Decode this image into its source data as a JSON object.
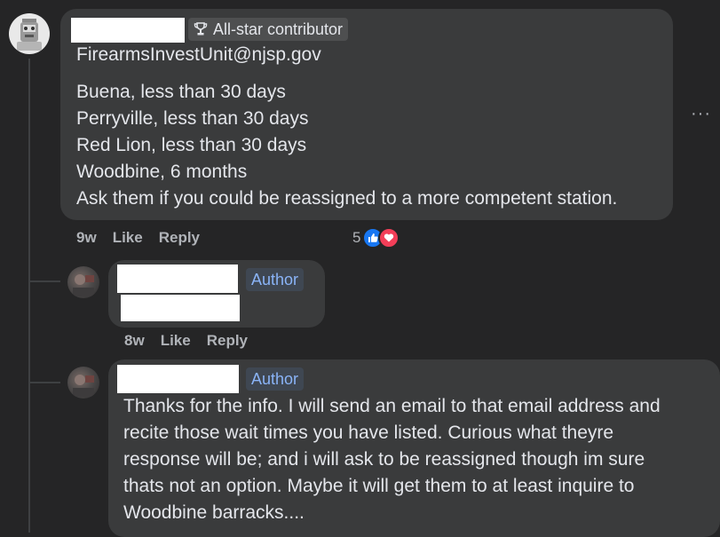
{
  "comments": [
    {
      "badge": "All-star contributor",
      "lines": [
        "FirearmsInvestUnit@njsp.gov",
        "Buena, less than 30 days",
        "Perryville, less than 30 days",
        "Red Lion, less than 30 days",
        "Woodbine, 6 months",
        "Ask them if you could be reassigned to a more competent station."
      ],
      "time": "9w",
      "like_label": "Like",
      "reply_label": "Reply",
      "reaction_count": "5",
      "more_label": "···"
    },
    {
      "badge": "Author",
      "time": "8w",
      "like_label": "Like",
      "reply_label": "Reply"
    },
    {
      "badge": "Author",
      "lines": [
        "Thanks for the info. I will send an email to that email address and",
        "recite those wait times you have listed. Curious what theyre",
        "response will be; and i will ask to be reassigned though im sure",
        "thats not an option. Maybe it will get them to at least inquire to",
        "Woodbine barracks...."
      ]
    }
  ],
  "colors": {
    "background": "#252526",
    "bubble": "#3a3b3c",
    "author_badge_text": "#8ab4f8",
    "like_blue": "#1877f2",
    "love_red": "#f33e58"
  },
  "icons": {
    "badge_icon": "trophy-icon",
    "reaction_1": "like-icon",
    "reaction_2": "love-icon",
    "more": "more-options-icon"
  }
}
